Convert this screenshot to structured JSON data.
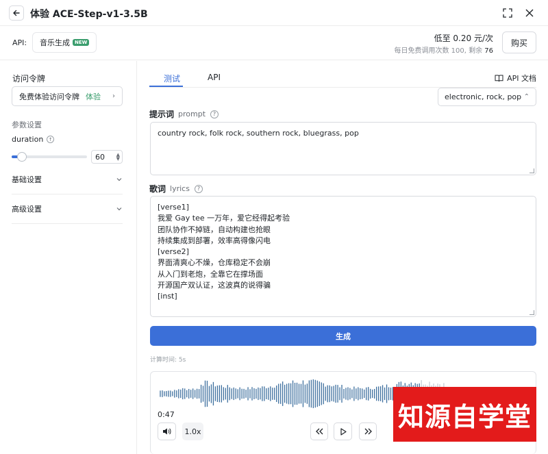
{
  "window": {
    "title": "体验  ACE-Step-v1-3.5B"
  },
  "api_bar": {
    "label": "API:",
    "chip_label": "音乐生成",
    "chip_badge": "NEW",
    "price": "低至 0.20 元/次",
    "quota_prefix": "每日免费调用次数 100, 剩余",
    "quota_remaining": "76",
    "buy_label": "购买"
  },
  "sidebar": {
    "token_label": "访问令牌",
    "token_value": "免费体验访问令牌",
    "token_tag": "体验",
    "params_title": "参数设置",
    "duration_label": "duration",
    "duration_value": "60",
    "duration_fraction": 0.14,
    "basic_settings": "基础设置",
    "advanced_settings": "高级设置"
  },
  "main": {
    "tabs": [
      {
        "label": "测试"
      },
      {
        "label": "API"
      }
    ],
    "api_doc_label": "API 文档",
    "style_select": "electronic, rock, pop",
    "prompt_label": "提示词",
    "prompt_en": "prompt",
    "prompt_value": "country rock, folk rock, southern rock, bluegrass, pop",
    "lyrics_label": "歌词",
    "lyrics_en": "lyrics",
    "lyrics_lines": [
      "[verse1]",
      "我爱 Gay tee 一万年，爱它经得起考验",
      "团队协作不掉链，自动构建也抢眼",
      "持续集成到部署，效率高得像闪电",
      "[verse2]",
      "界面清爽心不燥，仓库稳定不会崩",
      "从入门到老炮，全靠它在撑场面",
      "开源国产双认证，这波真的说得骗",
      "[inst]"
    ],
    "generate_label": "生成",
    "calc_time": "计算时间: 5s"
  },
  "player": {
    "current_time": "0:47",
    "speed": "1.0x",
    "played_color": "#3d6f9e",
    "unplayed_color": "#c5ccd6"
  },
  "watermark": "知源自学堂"
}
